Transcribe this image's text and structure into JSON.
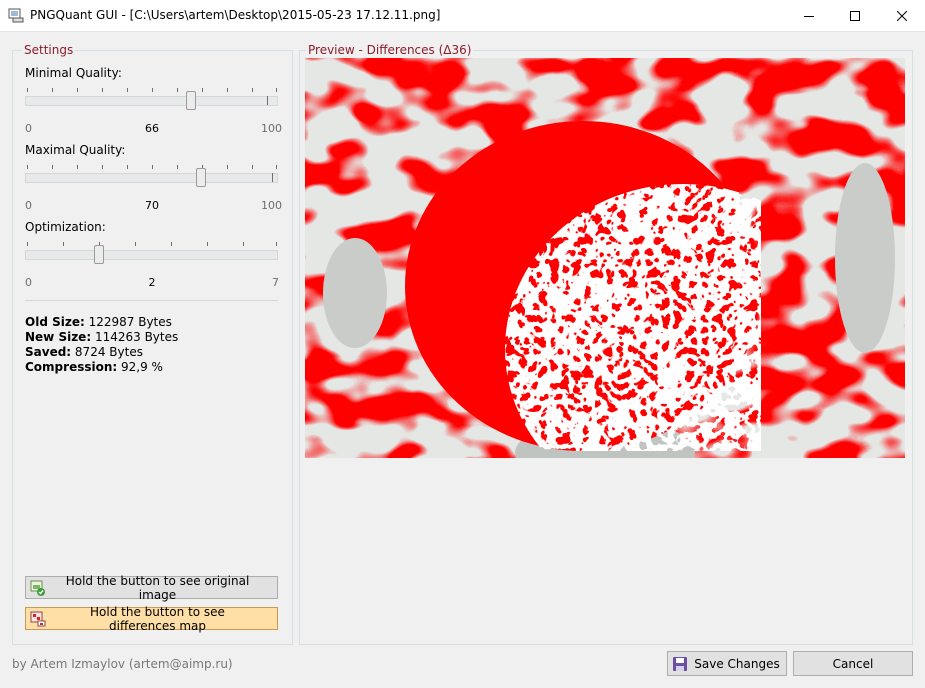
{
  "window": {
    "title": "PNGQuant GUI - [C:\\Users\\artem\\Desktop\\2015-05-23 17.12.11.png]",
    "controls": [
      "minimize-icon",
      "maximize-icon",
      "close-icon"
    ]
  },
  "settings": {
    "legend": "Settings",
    "sliders": [
      {
        "label": "Minimal Quality:",
        "min": "0",
        "max": "100",
        "value": "66"
      },
      {
        "label": "Maximal Quality:",
        "min": "0",
        "max": "100",
        "value": "70"
      },
      {
        "label": "Optimization:",
        "min": "0",
        "max": "7",
        "value": "2"
      }
    ],
    "info": {
      "old_size_label": "Old Size:",
      "old_size_value": "122987 Bytes",
      "new_size_label": "New Size:",
      "new_size_value": "114263 Bytes",
      "saved_label": "Saved:",
      "saved_value": "8724 Bytes",
      "compression_label": "Compression:",
      "compression_value": "92,9 %"
    },
    "buttons": {
      "original": "Hold the button to see original image",
      "differences": "Hold the button to see differences map"
    }
  },
  "preview": {
    "legend": "Preview - Differences (Δ36)"
  },
  "footer": {
    "credit": "by Artem Izmaylov (artem@aimp.ru)",
    "save_label": "Save Changes",
    "cancel_label": "Cancel"
  },
  "colors": {
    "accent_legend": "#8b1c2c",
    "diff_red": "#ff0000",
    "diff_gray": "#c8ccc8",
    "active_button": "#ffdfa6"
  }
}
